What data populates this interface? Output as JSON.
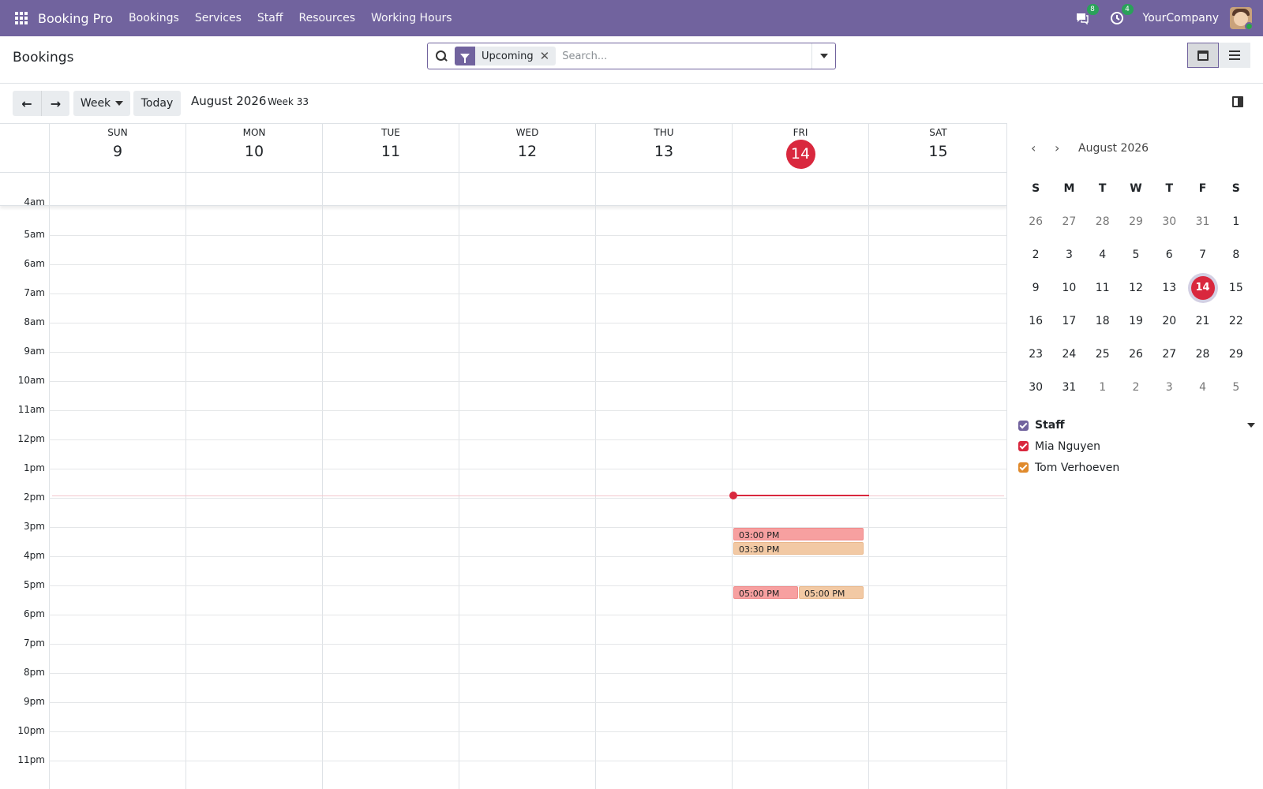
{
  "navbar": {
    "brand": "Booking Pro",
    "menu": [
      "Bookings",
      "Services",
      "Staff",
      "Resources",
      "Working Hours"
    ],
    "messages_count": "8",
    "activities_count": "4",
    "company": "YourCompany"
  },
  "control": {
    "title": "Bookings",
    "facet_label": "Upcoming",
    "search_placeholder": "Search...",
    "views": [
      "calendar-icon",
      "list-icon"
    ]
  },
  "toolbar": {
    "prev": "←",
    "next": "→",
    "scale": "Week",
    "today": "Today",
    "period": "August 2026",
    "week": "Week 33"
  },
  "calendar": {
    "days": [
      {
        "name": "SUN",
        "num": "9"
      },
      {
        "name": "MON",
        "num": "10"
      },
      {
        "name": "TUE",
        "num": "11"
      },
      {
        "name": "WED",
        "num": "12"
      },
      {
        "name": "THU",
        "num": "13"
      },
      {
        "name": "FRI",
        "num": "14",
        "today": true
      },
      {
        "name": "SAT",
        "num": "15"
      }
    ],
    "hours": [
      "4am",
      "5am",
      "6am",
      "7am",
      "8am",
      "9am",
      "10am",
      "11am",
      "12pm",
      "1pm",
      "2pm",
      "3pm",
      "4pm",
      "5pm",
      "6pm",
      "7pm",
      "8pm",
      "9pm",
      "10pm",
      "11pm"
    ],
    "events": [
      {
        "label": "03:00 PM",
        "color": "#f7a0a0"
      },
      {
        "label": "03:30 PM",
        "color": "#f2c9a4"
      },
      {
        "label": "05:00 PM",
        "color": "#f7a0a0"
      },
      {
        "label": "05:00 PM",
        "color": "#f2c9a4"
      }
    ]
  },
  "minical": {
    "title": "August 2026",
    "dow": [
      "S",
      "M",
      "T",
      "W",
      "T",
      "F",
      "S"
    ],
    "weeks": [
      [
        "26",
        "27",
        "28",
        "29",
        "30",
        "31",
        "1"
      ],
      [
        "2",
        "3",
        "4",
        "5",
        "6",
        "7",
        "8"
      ],
      [
        "9",
        "10",
        "11",
        "12",
        "13",
        "14",
        "15"
      ],
      [
        "16",
        "17",
        "18",
        "19",
        "20",
        "21",
        "22"
      ],
      [
        "23",
        "24",
        "25",
        "26",
        "27",
        "28",
        "29"
      ],
      [
        "30",
        "31",
        "1",
        "2",
        "3",
        "4",
        "5"
      ]
    ],
    "today": "14"
  },
  "filters": {
    "title": "Staff",
    "title_color": "#71639e",
    "items": [
      {
        "label": "Mia Nguyen",
        "color": "#d9283e"
      },
      {
        "label": "Tom Verhoeven",
        "color": "#e08a2c"
      }
    ]
  },
  "colors": {
    "brand": "#71639e",
    "today": "#d9283e"
  }
}
